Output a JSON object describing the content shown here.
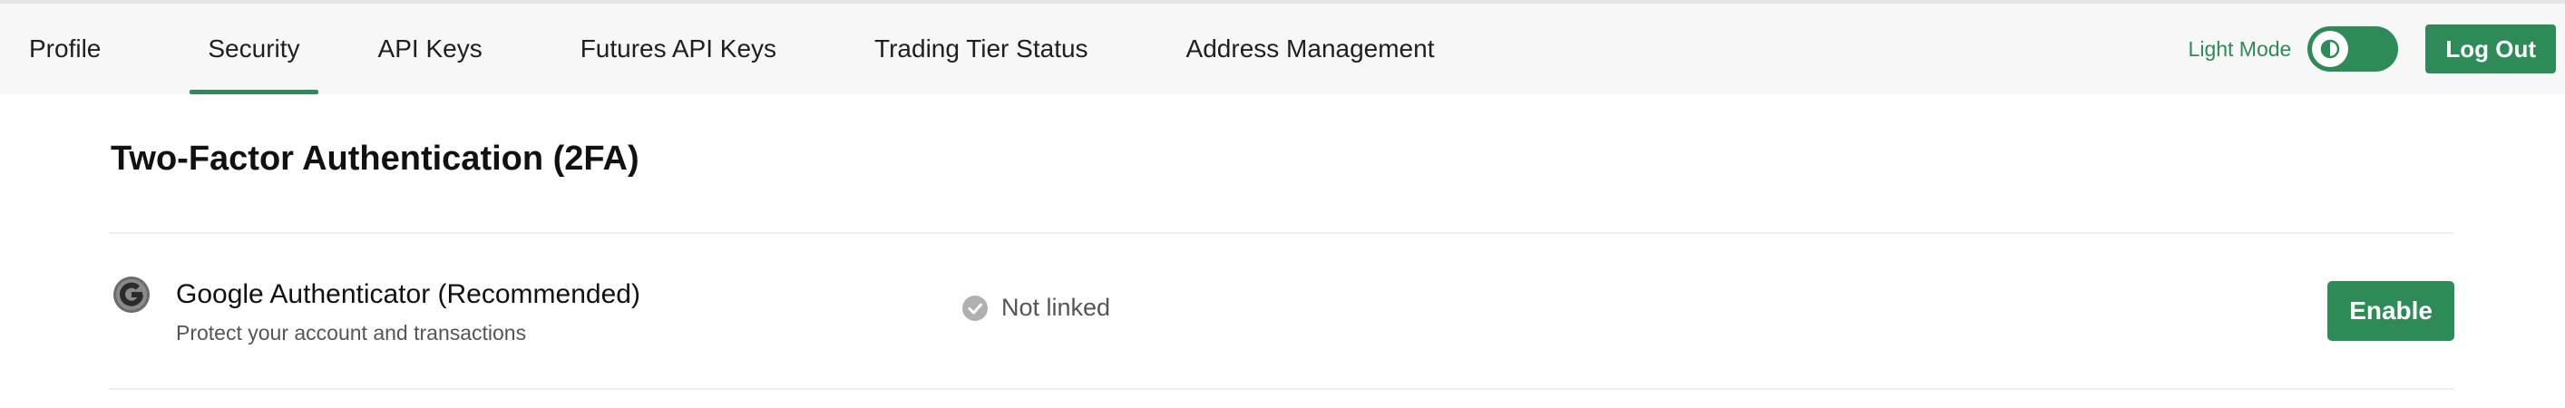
{
  "nav": {
    "tabs": [
      {
        "label": "Profile",
        "active": false
      },
      {
        "label": "Security",
        "active": true
      },
      {
        "label": "API Keys",
        "active": false
      },
      {
        "label": "Futures API Keys",
        "active": false
      },
      {
        "label": "Trading Tier Status",
        "active": false
      },
      {
        "label": "Address Management",
        "active": false
      }
    ],
    "theme_label": "Light Mode",
    "theme_toggle_icon": "contrast-icon",
    "logout_label": "Log Out"
  },
  "section": {
    "title": "Two-Factor Authentication (2FA)"
  },
  "methods": [
    {
      "icon": "google-authenticator-icon",
      "title": "Google Authenticator (Recommended)",
      "subtitle": "Protect your account and transactions",
      "status_icon": "check-circle-icon",
      "status": "Not linked",
      "action_label": "Enable"
    }
  ],
  "colors": {
    "accent": "#2e8b57",
    "topbar_bg": "#f7f7f7",
    "status_gray": "#b0b0b0"
  }
}
